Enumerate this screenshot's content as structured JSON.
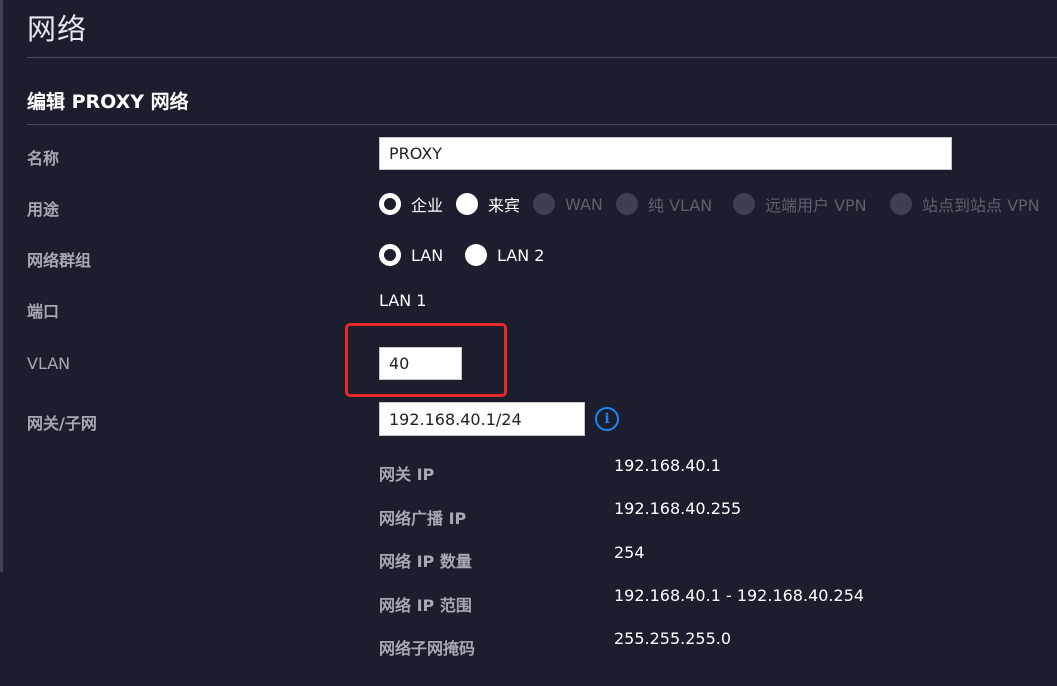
{
  "page": {
    "title": "网络"
  },
  "section": {
    "title": "编辑 PROXY 网络"
  },
  "fields": {
    "name": {
      "label": "名称",
      "value": "PROXY"
    },
    "purpose": {
      "label": "用途",
      "options": [
        {
          "label": "企业",
          "state": "checked"
        },
        {
          "label": "来宾",
          "state": "unchecked"
        },
        {
          "label": "WAN",
          "state": "disabled"
        },
        {
          "label": "纯 VLAN",
          "state": "disabled"
        },
        {
          "label": "远端用户 VPN",
          "state": "disabled"
        },
        {
          "label": "站点到站点 VPN",
          "state": "disabled"
        }
      ]
    },
    "network_group": {
      "label": "网络群组",
      "options": [
        {
          "label": "LAN",
          "state": "checked"
        },
        {
          "label": "LAN 2",
          "state": "unchecked"
        }
      ]
    },
    "port": {
      "label": "端口",
      "value": "LAN 1"
    },
    "vlan": {
      "label": "VLAN",
      "value": "40"
    },
    "gateway_subnet": {
      "label": "网关/子网",
      "value": "192.168.40.1/24",
      "info_icon": "info-icon",
      "info_glyph": "i"
    }
  },
  "details": [
    {
      "label": "网关 IP",
      "value": "192.168.40.1"
    },
    {
      "label": "网络广播 IP",
      "value": "192.168.40.255"
    },
    {
      "label": "网络 IP 数量",
      "value": "254"
    },
    {
      "label": "网络 IP 范围",
      "value": "192.168.40.1 - 192.168.40.254"
    },
    {
      "label": "网络子网掩码",
      "value": "255.255.255.0"
    }
  ],
  "colors": {
    "background": "#1c1e2d",
    "highlight": "#e62a2a",
    "info": "#1e87f0"
  }
}
